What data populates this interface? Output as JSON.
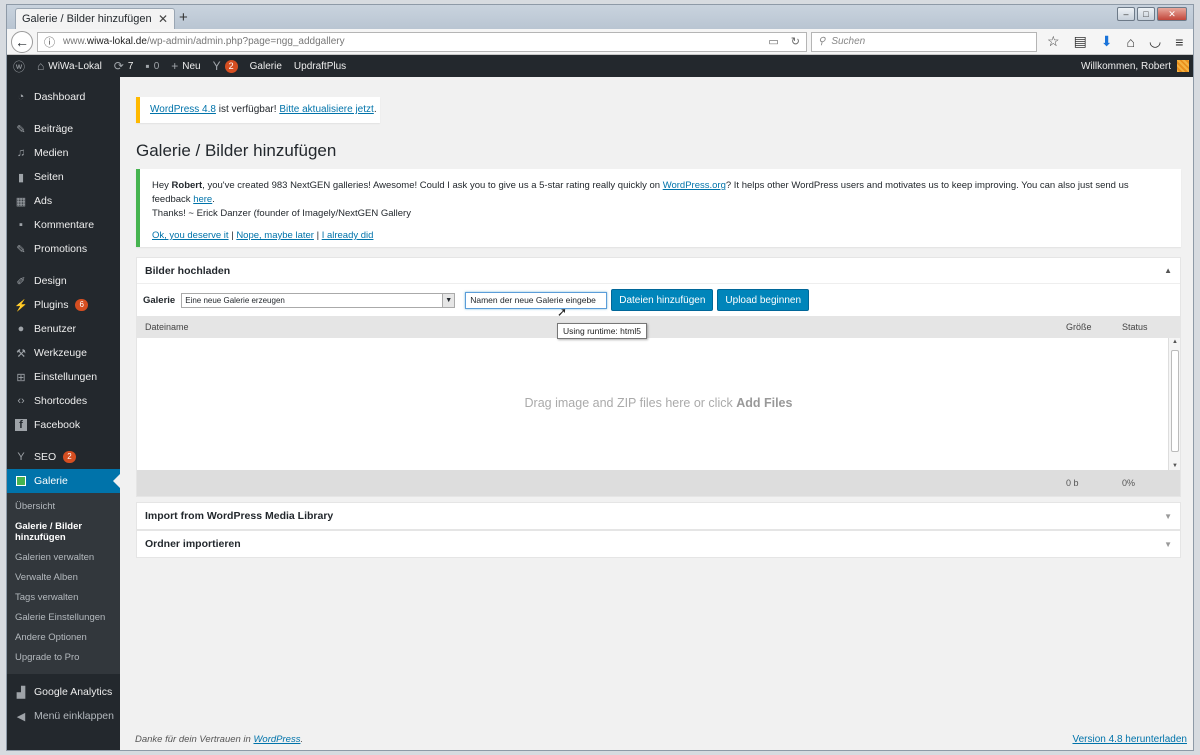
{
  "browser": {
    "tab_title": "Galerie / Bilder hinzufügen ‹ WiW",
    "url_prefix": "www.",
    "url_domain": "wiwa-lokal.de",
    "url_path": "/wp-admin/admin.php?page=ngg_addgallery",
    "search_placeholder": "Suchen"
  },
  "adminbar": {
    "site_name": "WiWa-Lokal",
    "updates_count": "7",
    "comments_count": "0",
    "new_label": "Neu",
    "seo_count": "2",
    "galerie_label": "Galerie",
    "updraft_label": "UpdraftPlus",
    "welcome": "Willkommen, Robert"
  },
  "sidebar": {
    "dashboard": "Dashboard",
    "beitraege": "Beiträge",
    "medien": "Medien",
    "seiten": "Seiten",
    "ads": "Ads",
    "kommentare": "Kommentare",
    "promotions": "Promotions",
    "design": "Design",
    "plugins": "Plugins",
    "plugins_count": "6",
    "benutzer": "Benutzer",
    "werkzeuge": "Werkzeuge",
    "einstellungen": "Einstellungen",
    "shortcodes": "Shortcodes",
    "facebook": "Facebook",
    "seo": "SEO",
    "seo_count": "2",
    "galerie": "Galerie",
    "sub": [
      "Übersicht",
      "Galerie / Bilder hinzufügen",
      "Galerien verwalten",
      "Verwalte Alben",
      "Tags verwalten",
      "Galerie Einstellungen",
      "Andere Optionen",
      "Upgrade to Pro"
    ],
    "google_analytics": "Google Analytics",
    "collapse": "Menü einklappen"
  },
  "update_notice": {
    "version_link": "WordPress 4.8",
    "text": " ist verfügbar! ",
    "update_link": "Bitte aktualisiere jetzt",
    "end": "."
  },
  "page_title": "Galerie / Bilder hinzufügen",
  "ngg_notice": {
    "t1": "Hey ",
    "name": "Robert",
    "t2": ", you've created 983 NextGEN galleries! Awesome! Could I ask you to give us a 5-star rating really quickly on ",
    "wp_link": "WordPress.org",
    "t3": "? It helps other WordPress users and motivates us to keep improving. You can also just send us feedback ",
    "here_link": "here",
    "t4": ".",
    "t5": "Thanks! ~ Erick Danzer (founder of Imagely/NextGEN Gallery",
    "link_yes": "Ok, you deserve it",
    "link_later": "Nope, maybe later",
    "link_did": "I already did"
  },
  "upload": {
    "title": "Bilder hochladen",
    "gallery_label": "Galerie",
    "select_value": "Eine neue Galerie erzeugen",
    "name_value": "Namen der neue Galerie eingebe",
    "add_files": "Dateien hinzufügen",
    "start_upload": "Upload beginnen",
    "col_filename": "Dateiname",
    "col_size": "Größe",
    "col_status": "Status",
    "drop_text": "Drag image and ZIP files here or click ",
    "drop_bold": "Add Files",
    "total_size": "0 b",
    "total_pct": "0%",
    "tooltip": "Using runtime: html5"
  },
  "import_media": "Import from WordPress Media Library",
  "import_folder": "Ordner importieren",
  "footer": {
    "thanks": "Danke für dein Vertrauen in ",
    "wp_link": "WordPress",
    "end": ".",
    "version": "Version 4.8 herunterladen"
  }
}
